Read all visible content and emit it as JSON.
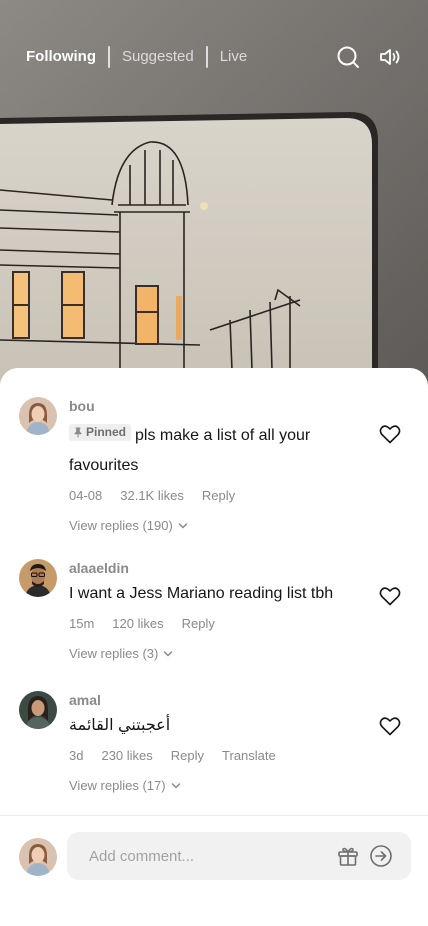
{
  "top_tabs": {
    "following": "Following",
    "suggested": "Suggested",
    "live": "Live",
    "icons": [
      "search-icon",
      "speaker-icon"
    ]
  },
  "comments": [
    {
      "username": "bou",
      "pinned_label": "Pinned",
      "text": "pls make a list of all your favourites",
      "date": "04-08",
      "likes": "32.1K likes",
      "reply": "Reply",
      "view_replies": "View replies (190)"
    },
    {
      "username": "alaaeldin",
      "text": "I want a Jess Mariano reading list tbh",
      "date": "15m",
      "likes": "120 likes",
      "reply": "Reply",
      "view_replies": "View replies (3)"
    },
    {
      "username": "amal",
      "text": "أعجبتني القائمة",
      "date": "3d",
      "likes": "230 likes",
      "reply": "Reply",
      "translate": "Translate",
      "view_replies": "View replies (17)"
    }
  ],
  "composer": {
    "placeholder": "Add comment...",
    "icons": [
      "gift-icon",
      "send-icon"
    ]
  },
  "colors": {
    "text": "#161616",
    "muted": "#8a8a8a",
    "pinned_bg": "#efefef",
    "input_bg": "#f1f1f2"
  }
}
